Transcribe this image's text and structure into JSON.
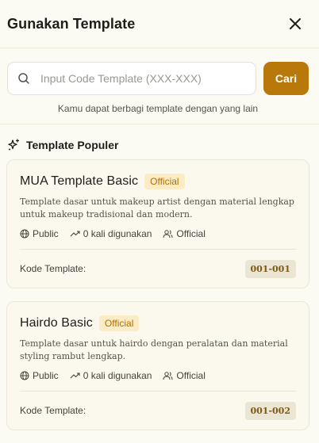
{
  "header": {
    "title": "Gunakan Template"
  },
  "search": {
    "placeholder": "Input Code Template (XXX-XXX)",
    "button_label": "Cari",
    "hint": "Kamu dapat berbagi template dengan yang lain"
  },
  "popular": {
    "title": "Template Populer",
    "cards": [
      {
        "title": "MUA Template Basic",
        "badge": "Official",
        "description": "Template dasar untuk makeup artist dengan material lengkap untuk makeup tradisional dan modern.",
        "visibility": "Public",
        "usage": "0 kali digunakan",
        "owner": "Official",
        "code_label": "Kode Template:",
        "code": "001-001"
      },
      {
        "title": "Hairdo Basic",
        "badge": "Official",
        "description": "Template dasar untuk hairdo dengan peralatan dan material styling rambut lengkap.",
        "visibility": "Public",
        "usage": "0 kali digunakan",
        "owner": "Official",
        "code_label": "Kode Template:",
        "code": "001-002"
      }
    ]
  },
  "colors": {
    "accent": "#b8780a",
    "badge_bg": "#fbecc6",
    "badge_text": "#b36f00",
    "background": "#fcfbf3"
  }
}
